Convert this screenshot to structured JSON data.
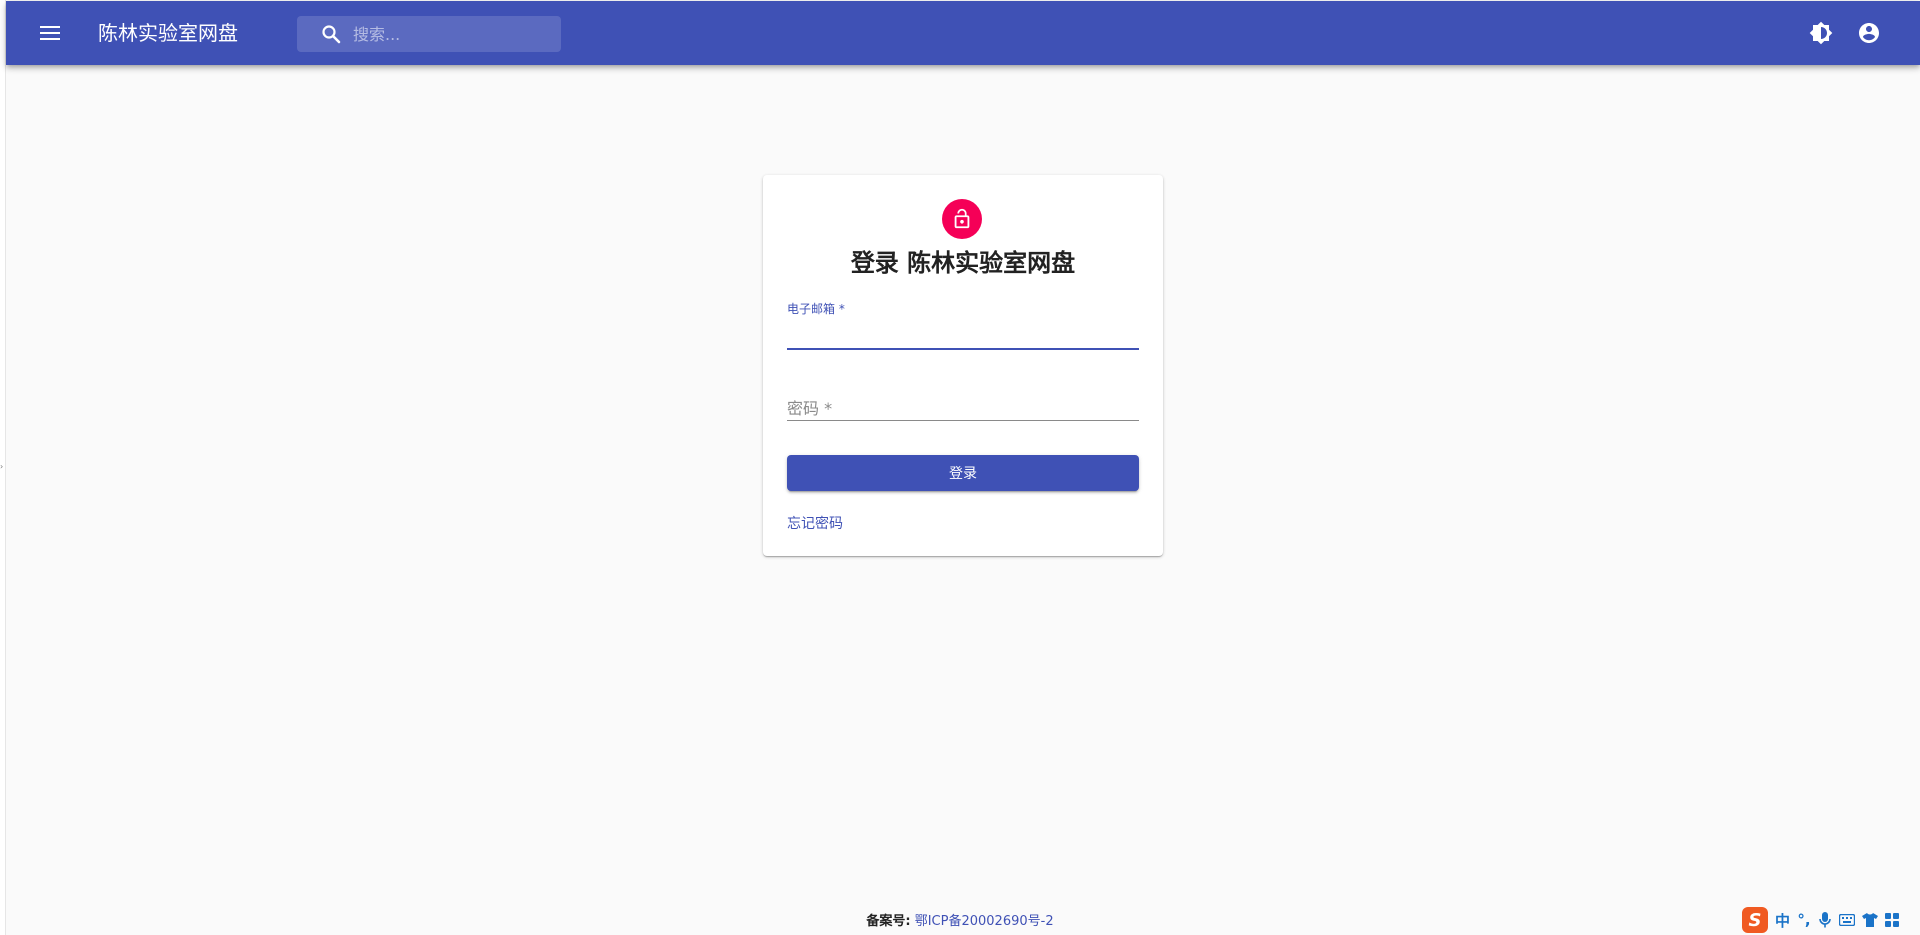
{
  "appbar": {
    "title": "陈林实验室网盘",
    "search": {
      "placeholder": "搜索..."
    }
  },
  "login": {
    "title": "登录 陈林实验室网盘",
    "email_label": "电子邮箱 *",
    "email_value": "",
    "password_label": "密码 *",
    "password_value": "",
    "submit_label": "登录",
    "forgot_label": "忘记密码"
  },
  "footer": {
    "icp_label": "备案号:",
    "icp_number": "鄂ICP备20002690号-2"
  },
  "ime": {
    "logo": "S",
    "mode": "中",
    "punct": "°,",
    "icons": [
      "microphone-icon",
      "keyboard-icon",
      "shirt-icon",
      "grid-icon"
    ]
  },
  "colors": {
    "primary": "#3f51b5",
    "accent": "#f50057",
    "background": "#fafafa"
  }
}
